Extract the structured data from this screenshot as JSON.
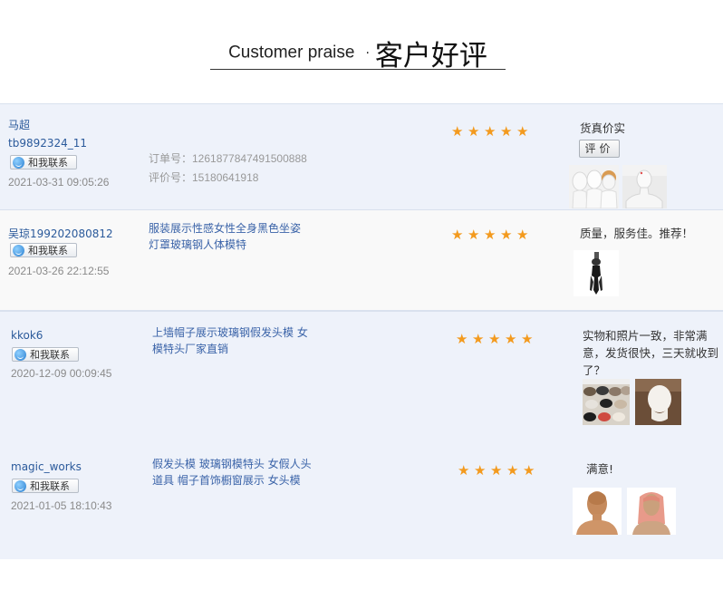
{
  "header": {
    "title_en": "Customer praise",
    "separator": "·",
    "title_zh": "客户好评"
  },
  "contact_label": "和我联系",
  "rate_button_label": "评价",
  "star_rating_max": 5,
  "reviews": [
    {
      "user": "马超",
      "user_id": "tb9892324_11",
      "date": "2021-03-31 09:05:26",
      "order_no": "订单号：1261877847491500888",
      "review_no": "评价号：15180641918",
      "rating": 5,
      "comment": "货真价实",
      "images": [
        "white-mannequin-heads-photo",
        "white-mannequin-bust-photo"
      ]
    },
    {
      "user": "吴琼199202080812",
      "date": "2021-03-26 22:12:55",
      "product": "服装展示性感女性全身黑色坐姿灯罩玻璃钢人体模特",
      "rating": 5,
      "comment": "质量，服务佳。推荐！",
      "images": [
        "black-mannequin-photo"
      ]
    },
    {
      "user": "kkok6",
      "date": "2020-12-09 00:09:45",
      "product": "上墙帽子展示玻璃钢假发头模 女模特头厂家直销",
      "rating": 5,
      "comment": "实物和照片一致，非常满意，发货很快，三天就收到了？",
      "images": [
        "hat-wall-display-photo",
        "white-head-form-photo"
      ]
    },
    {
      "user": "magic_works",
      "date": "2021-01-05 18:10:43",
      "product": "假发头模 玻璃钢模特头 女假人头道具 帽子首饰橱窗展示 女头模",
      "rating": 5,
      "comment": "满意!",
      "images": [
        "bald-mannequin-head-photo",
        "pink-hair-mannequin-photo"
      ]
    }
  ]
}
